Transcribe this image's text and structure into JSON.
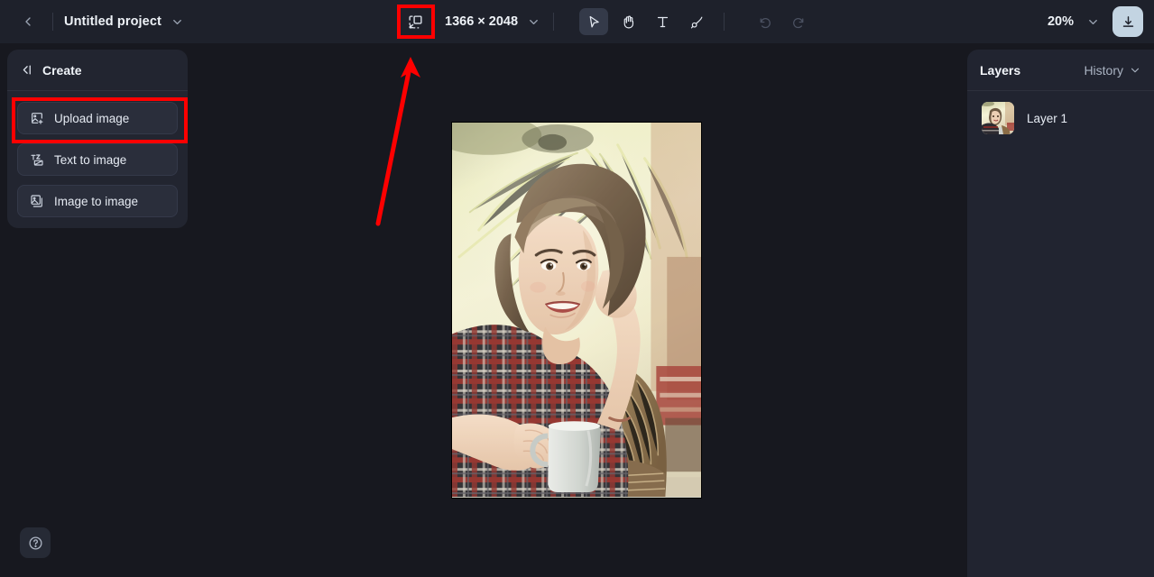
{
  "toolbar": {
    "back_icon": "chevron-left-icon",
    "project_title": "Untitled project",
    "project_dropdown_icon": "chevron-down-icon",
    "resize_icon": "resize-canvas-icon",
    "canvas_width": "1366",
    "canvas_dim_separator": "×",
    "canvas_height": "2048",
    "dimensions_label": "1366 × 2048",
    "dimensions_dropdown_icon": "chevron-down-icon",
    "tools": [
      {
        "name": "select-tool",
        "icon": "cursor-arrow-icon",
        "active": true
      },
      {
        "name": "hand-tool",
        "icon": "hand-icon",
        "active": false
      },
      {
        "name": "text-tool",
        "icon": "text-t-icon",
        "active": false
      },
      {
        "name": "brush-tool",
        "icon": "paintbrush-icon",
        "active": false
      }
    ],
    "undo_icon": "undo-arrow-icon",
    "redo_icon": "redo-arrow-icon",
    "zoom_level": "20%",
    "zoom_dropdown_icon": "chevron-down-icon",
    "download_icon": "download-icon"
  },
  "create_panel": {
    "collapse_icon": "collapse-panel-left-icon",
    "title": "Create",
    "items": [
      {
        "label": "Upload image",
        "icon": "image-plus-icon"
      },
      {
        "label": "Text to image",
        "icon": "text-to-image-icon"
      },
      {
        "label": "Image to image",
        "icon": "image-stack-icon"
      }
    ]
  },
  "help": {
    "icon": "question-mark-circle-icon"
  },
  "layers_panel": {
    "layers_tab": "Layers",
    "history_tab": "History",
    "history_dropdown_icon": "chevron-down-icon",
    "layers": [
      {
        "name": "Layer 1",
        "thumbnail": "portrait-photo-thumbnail"
      }
    ]
  },
  "canvas": {
    "artboard_image": "woman-with-mug-portrait-photo"
  },
  "annotations": {
    "highlight_color": "#fe0000",
    "highlighted_targets": [
      "upload-image-button",
      "resize-canvas-icon"
    ],
    "arrow": "red-arrow-pointing-to-resize-icon"
  }
}
